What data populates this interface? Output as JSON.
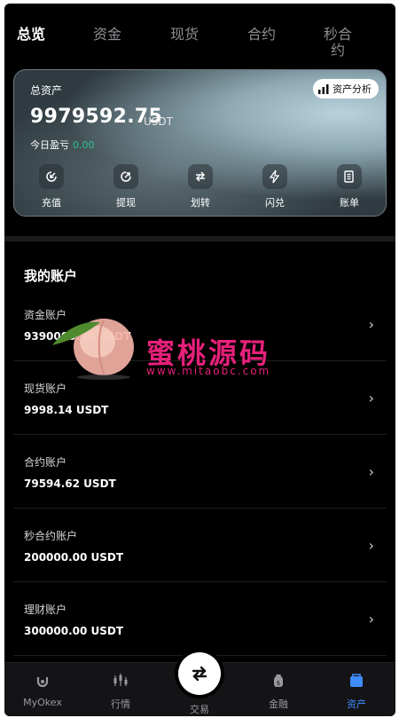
{
  "tabs": [
    {
      "label": "总览",
      "active": true
    },
    {
      "label": "资金",
      "active": false
    },
    {
      "label": "现货",
      "active": false
    },
    {
      "label": "合约",
      "active": false
    },
    {
      "label": "秒合约",
      "label_line1": "秒合",
      "label_line2": "约",
      "active": false
    }
  ],
  "card": {
    "title": "总资产",
    "analysis_label": "资产分析",
    "amount": "9979592.75",
    "unit": "USDT",
    "pnl_label": "今日盈亏",
    "pnl_value": "0.00",
    "actions": [
      {
        "label": "充值",
        "icon": "deposit-icon"
      },
      {
        "label": "提现",
        "icon": "withdraw-icon"
      },
      {
        "label": "划转",
        "icon": "transfer-icon"
      },
      {
        "label": "闪兑",
        "icon": "flash-icon"
      },
      {
        "label": "账单",
        "icon": "bill-icon"
      }
    ]
  },
  "section_title": "我的账户",
  "accounts": [
    {
      "name": "资金账户",
      "balance": "9390000.00 USDT"
    },
    {
      "name": "现货账户",
      "balance": "9998.14 USDT"
    },
    {
      "name": "合约账户",
      "balance": "79594.62 USDT"
    },
    {
      "name": "秒合约账户",
      "balance": "200000.00 USDT"
    },
    {
      "name": "理财账户",
      "balance": "300000.00 USDT"
    }
  ],
  "watermark": {
    "text": "蜜桃源码",
    "url": "www.mitaobc.com"
  },
  "nav": [
    {
      "label": "MyOkex",
      "icon": "myokex-icon",
      "active": false
    },
    {
      "label": "行情",
      "icon": "market-icon",
      "active": false
    },
    {
      "label": "交易",
      "icon": "trade-icon",
      "active": false
    },
    {
      "label": "金融",
      "icon": "finance-icon",
      "active": false
    },
    {
      "label": "资产",
      "icon": "assets-icon",
      "active": true
    }
  ],
  "colors": {
    "background": "#000000",
    "accent": "#3f8cff",
    "profit": "#2fc28b",
    "watermark": "#e6207a"
  }
}
